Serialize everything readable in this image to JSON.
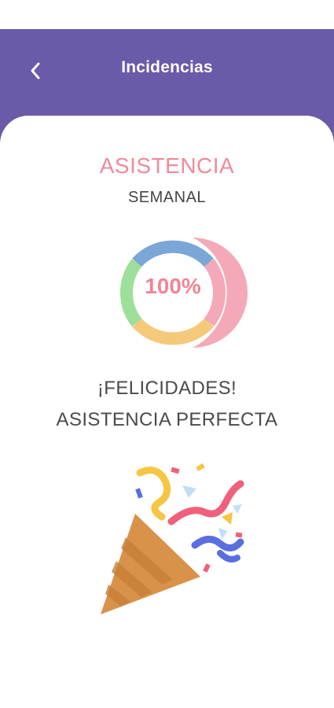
{
  "header": {
    "title": "Incidencias",
    "back_icon": "chevron-left-icon",
    "background": "#6a5aa8"
  },
  "attendance": {
    "title": "ASISTENCIA",
    "subtitle": "SEMANAL",
    "percentage_label": "100%",
    "percentage_value": 100,
    "ring_colors": [
      "#7aa7d8",
      "#f4a9b8",
      "#f5c97a",
      "#9ddf9b"
    ]
  },
  "message": {
    "line1": "¡FELICIDADES!",
    "line2": "ASISTENCIA PERFECTA"
  },
  "illustration": {
    "icon": "party-popper-icon"
  },
  "colors": {
    "accent": "#f08a9a",
    "header": "#6a5aa8"
  }
}
